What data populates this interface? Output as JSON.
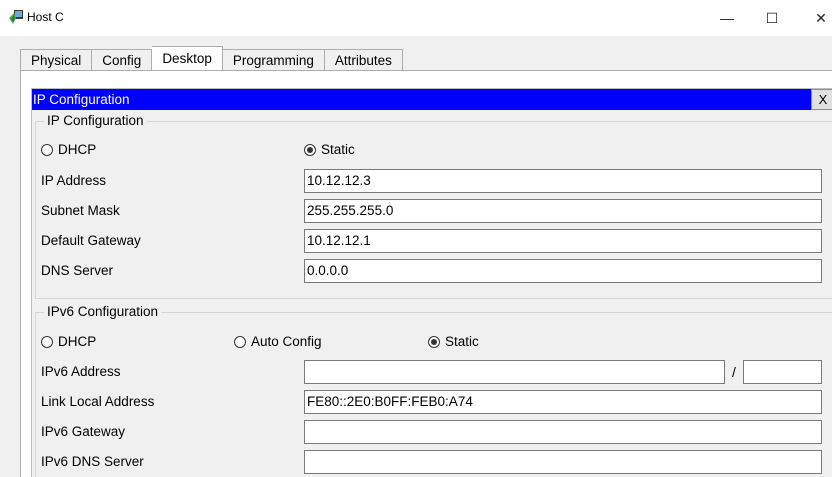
{
  "window": {
    "title": "Host C",
    "icon": "packet-tracer-pc-icon",
    "minimize_glyph": "—",
    "maximize_glyph": "☐",
    "close_glyph": "✕"
  },
  "tabs": [
    {
      "label": "Physical",
      "active": false
    },
    {
      "label": "Config",
      "active": false
    },
    {
      "label": "Desktop",
      "active": true
    },
    {
      "label": "Programming",
      "active": false
    },
    {
      "label": "Attributes",
      "active": false
    }
  ],
  "panel": {
    "title": "IP Configuration",
    "close_label": "X",
    "colors": {
      "header": "#0000ff",
      "header_text": "#ffffff"
    }
  },
  "ipv4": {
    "legend": "IP Configuration",
    "dhcp_label": "DHCP",
    "static_label": "Static",
    "selected_mode": "Static",
    "ip_address_label": "IP Address",
    "ip_address_value": "10.12.12.3",
    "subnet_mask_label": "Subnet Mask",
    "subnet_mask_value": "255.255.255.0",
    "default_gateway_label": "Default Gateway",
    "default_gateway_value": "10.12.12.1",
    "dns_server_label": "DNS Server",
    "dns_server_value": "0.0.0.0"
  },
  "ipv6": {
    "legend": "IPv6 Configuration",
    "dhcp_label": "DHCP",
    "auto_config_label": "Auto Config",
    "static_label": "Static",
    "selected_mode": "Static",
    "address_label": "IPv6 Address",
    "address_value": "",
    "prefix_separator": "/",
    "prefix_value": "",
    "link_local_label": "Link Local Address",
    "link_local_value": "FE80::2E0:B0FF:FEB0:A74",
    "gateway_label": "IPv6 Gateway",
    "gateway_value": "",
    "dns_server_label": "IPv6 DNS Server",
    "dns_server_value": ""
  }
}
